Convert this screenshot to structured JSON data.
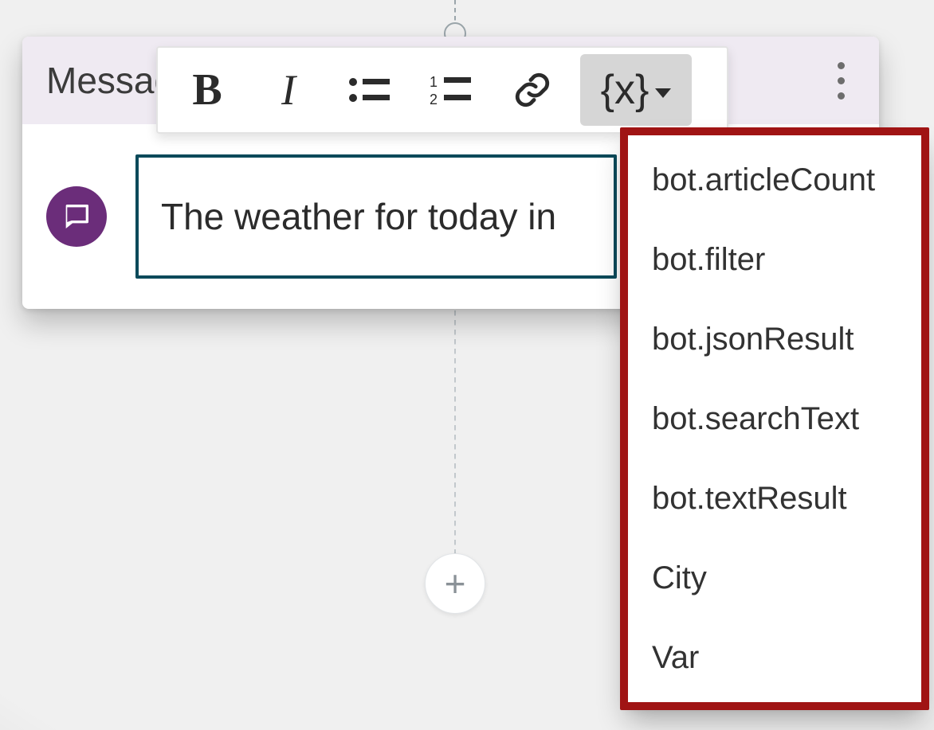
{
  "card": {
    "title": "Message"
  },
  "toolbar": {
    "bold_label": "B",
    "italic_label": "I",
    "var_label": "{x}"
  },
  "message": {
    "text": "The weather for today in"
  },
  "variables_dropdown": {
    "items": [
      "bot.articleCount",
      "bot.filter",
      "bot.jsonResult",
      "bot.searchText",
      "bot.textResult",
      "City",
      "Var"
    ]
  },
  "add_button_label": "+",
  "colors": {
    "accent_purple": "#6b2d7a",
    "input_border": "#0b4a5a",
    "highlight_ring": "#a01414",
    "toolbar_active_bg": "#d6d6d6",
    "header_bg": "#efeaf2"
  }
}
